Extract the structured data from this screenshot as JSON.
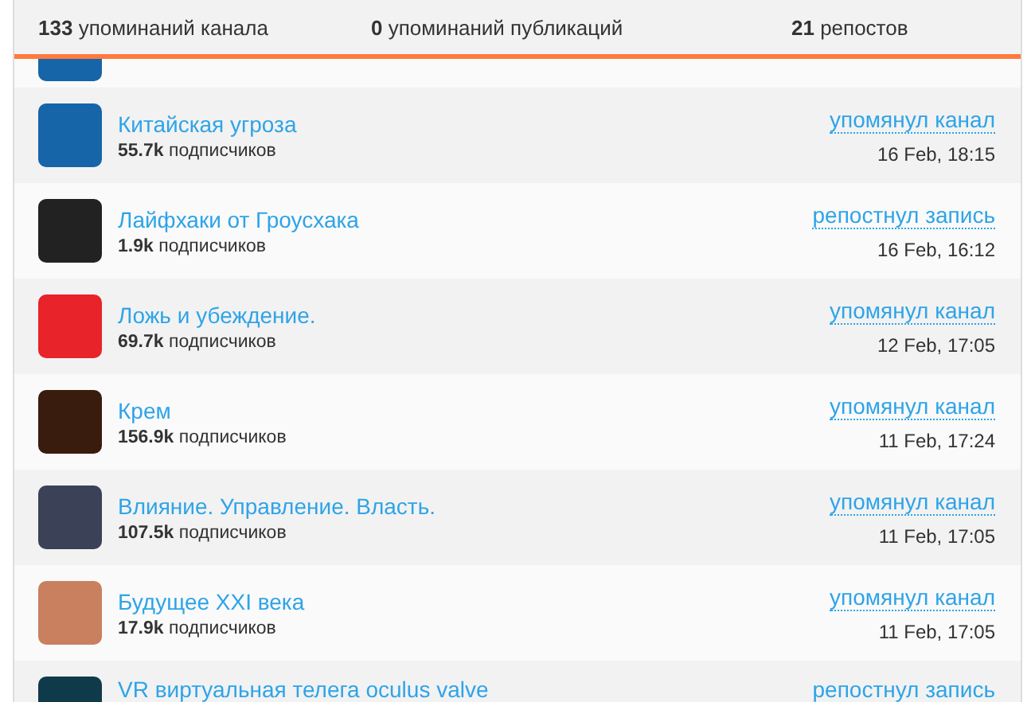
{
  "stats": [
    {
      "count": "133",
      "label": "упоминаний канала"
    },
    {
      "count": "0",
      "label": "упоминаний публикаций"
    },
    {
      "count": "21",
      "label": "репостов"
    }
  ],
  "mentions": [
    {
      "name": "Китайская угроза",
      "subscribers_count": "55.7k",
      "subscribers_label": "подписчиков",
      "action": "упомянул канал",
      "date": "16 Feb, 18:15"
    },
    {
      "name": "Лайфхаки от Гроусхака",
      "subscribers_count": "1.9k",
      "subscribers_label": "подписчиков",
      "action": "репостнул запись",
      "date": "16 Feb, 16:12"
    },
    {
      "name": "Ложь и убеждение.",
      "subscribers_count": "69.7k",
      "subscribers_label": "подписчиков",
      "action": "упомянул канал",
      "date": "12 Feb, 17:05"
    },
    {
      "name": "Крем",
      "subscribers_count": "156.9k",
      "subscribers_label": "подписчиков",
      "action": "упомянул канал",
      "date": "11 Feb, 17:24"
    },
    {
      "name": "Влияние. Управление. Власть.",
      "subscribers_count": "107.5k",
      "subscribers_label": "подписчиков",
      "action": "упомянул канал",
      "date": "11 Feb, 17:05"
    },
    {
      "name": "Будущее XXI века",
      "subscribers_count": "17.9k",
      "subscribers_label": "подписчиков",
      "action": "упомянул канал",
      "date": "11 Feb, 17:05"
    },
    {
      "name": "VR виртуальная телега oculus valve",
      "action": "репостнул запись"
    }
  ]
}
